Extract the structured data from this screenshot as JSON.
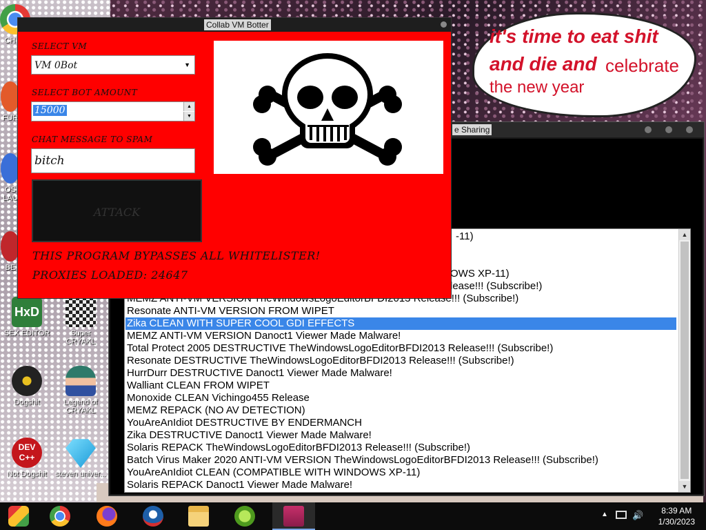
{
  "desktop_icons": [
    {
      "label": "CH D"
    },
    {
      "label": "FUR"
    },
    {
      "label": "OS LAU"
    },
    {
      "label": "BE"
    },
    {
      "label": "SEX EDITOR"
    },
    {
      "label": "Super CRYAKL"
    },
    {
      "label": "Dogshit"
    },
    {
      "label": "Legend of CRYAKL"
    },
    {
      "label": "Not Dogshit"
    },
    {
      "label": "steven univer..."
    }
  ],
  "bubble": {
    "line1": "it's time to eat shit",
    "line2a": "and die and",
    "line2b": "celebrate",
    "line3": "the new year"
  },
  "back_window": {
    "title": "e Sharing",
    "partial_items": [
      "-11)",
      "OWS XP-11)",
      "lease!!! (Subscribe!)",
      "MEMZ ANTI-VM VERSION TheWindowsLogoEditorBFDI2013 Release!!! (Subscribe!)"
    ],
    "items": [
      "Resonate ANTI-VM VERSION FROM WIPET",
      "Zika CLEAN WITH SUPER COOL GDI EFFECTS",
      "MEMZ ANTI-VM VERSION Danoct1 Viewer Made Malware!",
      "Total Protect 2005 DESTRUCTIVE TheWindowsLogoEditorBFDI2013 Release!!! (Subscribe!)",
      "Resonate DESTRUCTIVE TheWindowsLogoEditorBFDI2013 Release!!! (Subscribe!)",
      "HurrDurr DESTRUCTIVE Danoct1 Viewer Made Malware!",
      "Walliant CLEAN FROM WIPET",
      "Monoxide CLEAN Vichingo455 Release",
      "MEMZ REPACK (NO AV DETECTION)",
      "YouAreAnIdiot DESTRUCTIVE BY ENDERMANCH",
      "Zika DESTRUCTIVE Danoct1 Viewer Made Malware!",
      "Solaris REPACK TheWindowsLogoEditorBFDI2013 Release!!! (Subscribe!)",
      "Batch Virus Maker 2020 ANTI-VM VERSION TheWindowsLogoEditorBFDI2013 Release!!! (Subscribe!)",
      "YouAreAnIdiot CLEAN (COMPATIBLE WITH WINDOWS XP-11)",
      "Solaris REPACK Danoct1 Viewer Made Malware!"
    ],
    "selected_index": 1
  },
  "botter": {
    "title": "Collab VM Botter",
    "select_vm_label": "SELECT VM",
    "select_vm_value": "VM 0Bot",
    "bot_amount_label": "SELECT BOT AMOUNT",
    "bot_amount_value": "15000",
    "chat_label": "CHAT MESSAGE TO SPAM",
    "chat_value": "bitch",
    "attack_label": "ATTACK",
    "note1": "THIS PROGRAM BYPASSES ALL WHITELISTER!",
    "note2": "PROXIES LOADED: 24647"
  },
  "taskbar": {
    "apps": [
      "chrome-remote-icon",
      "chrome-icon",
      "firefox-icon",
      "obama-icon",
      "file-explorer-icon",
      "lime-app-icon",
      "monitor-app-icon"
    ],
    "time": "8:39 AM",
    "date": "1/30/2023"
  },
  "colors": {
    "window_red": "#ff0000",
    "selection": "#3a86e8",
    "bubble_text": "#d3122a"
  }
}
